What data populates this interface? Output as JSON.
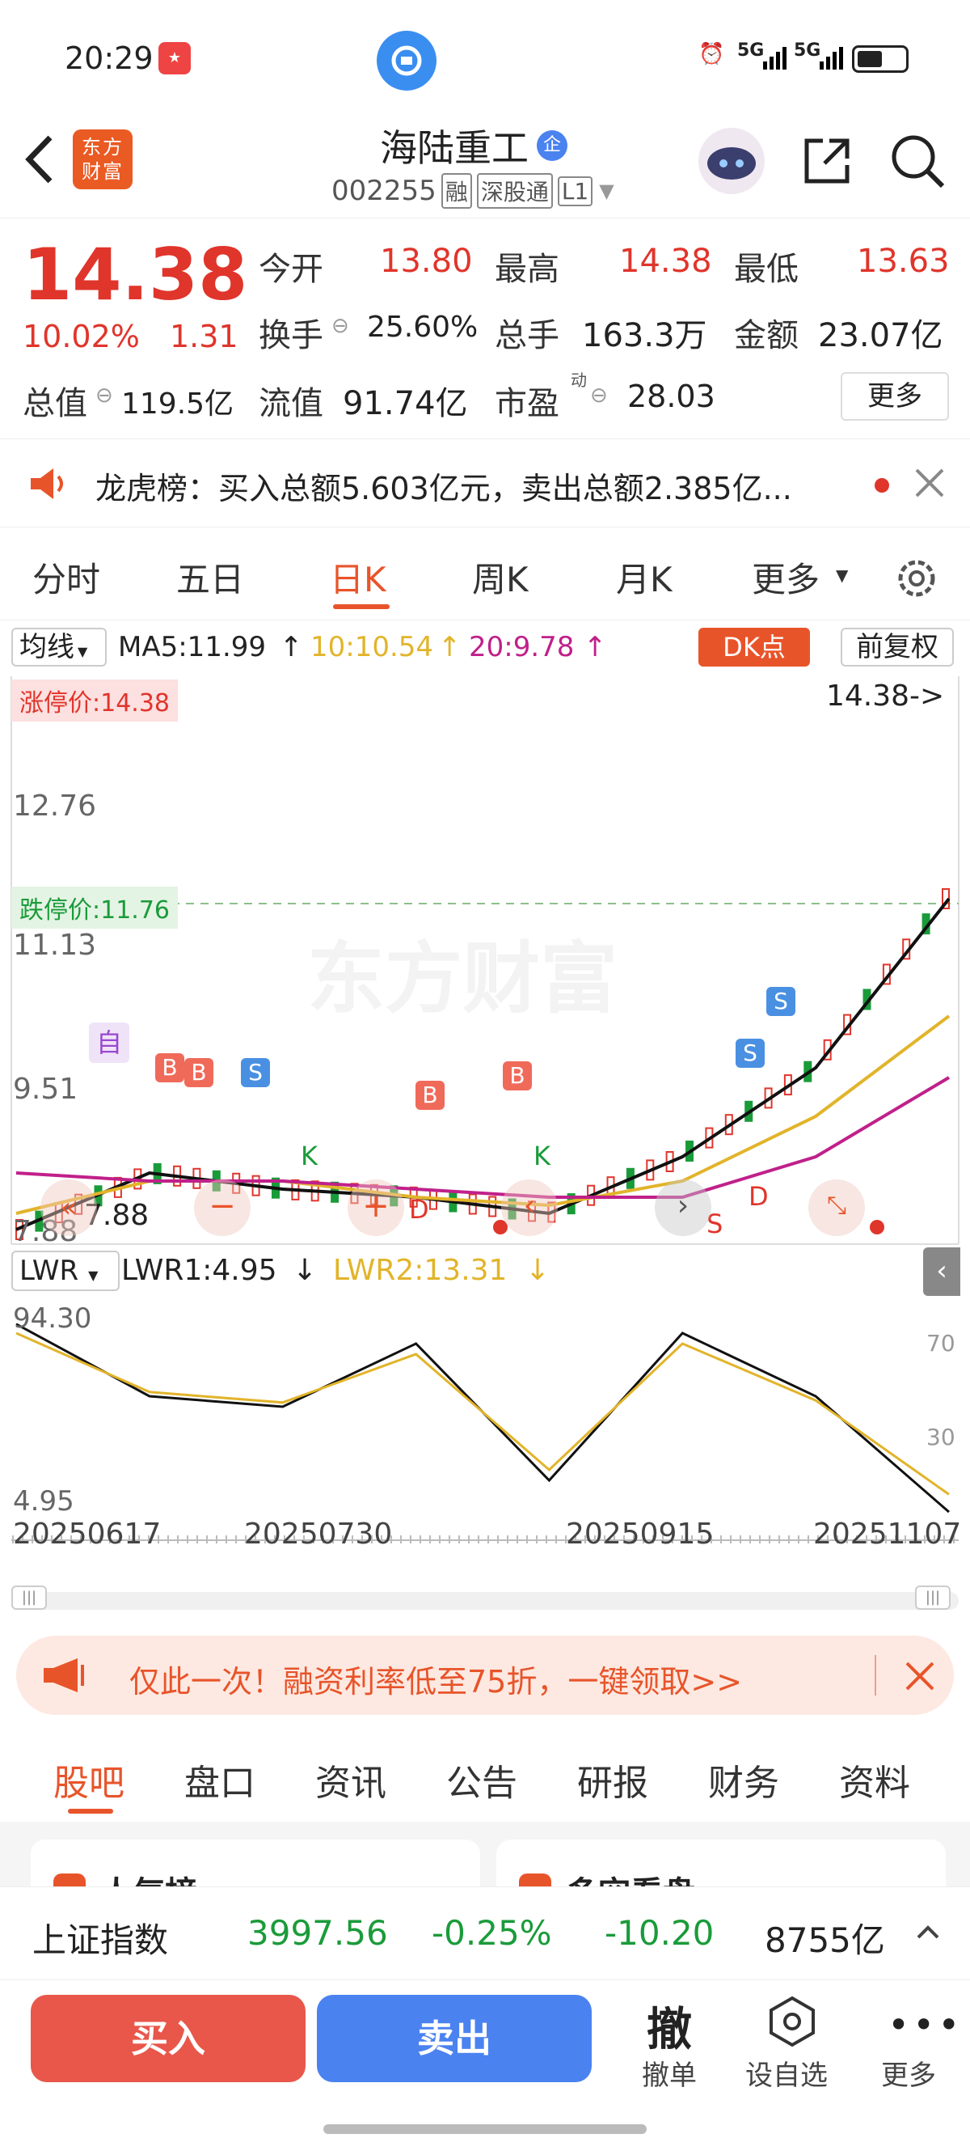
{
  "status_bar": {
    "time": "20:29",
    "signal1": "5G",
    "signal2": "5G"
  },
  "header": {
    "logo_text": "东方财富",
    "stock_name": "海陆重工",
    "badge": "企",
    "code": "002255",
    "tags": [
      "融",
      "深股通",
      "L1"
    ]
  },
  "quote": {
    "price": "14.38",
    "change_pct": "10.02%",
    "change": "1.31",
    "open_label": "今开",
    "open": "13.80",
    "high_label": "最高",
    "high": "14.38",
    "low_label": "最低",
    "low": "13.63",
    "turnover_label": "换手",
    "turnover": "25.60%",
    "volume_label": "总手",
    "volume": "163.3万",
    "amount_label": "金额",
    "amount": "23.07亿",
    "mktcap_label": "总值",
    "mktcap": "119.5亿",
    "float_label": "流值",
    "float": "91.74亿",
    "pe_label": "市盈",
    "pe_sup": "动",
    "pe": "28.03",
    "more_button": "更多"
  },
  "notice": {
    "text": "龙虎榜：买入总额5.603亿元，卖出总额2.385亿..."
  },
  "kline_tabs": {
    "items": [
      "分时",
      "五日",
      "日K",
      "周K",
      "月K",
      "更多"
    ],
    "active": 2
  },
  "indicator_bar": {
    "selector": "均线",
    "ma5": "MA5:11.99",
    "ma10": "10:10.54",
    "ma20": "20:9.78",
    "dk_button": "DK点",
    "adjust": "前复权"
  },
  "chart_labels": {
    "limit_up": "涨停价:14.38",
    "price_tag": "14.38->",
    "y_12_76": "12.76",
    "limit_down": "跌停价:11.76",
    "y_11_13": "11.13",
    "y_9_51": "9.51",
    "y_7_88": "7.88",
    "low_marker": "7.88",
    "watermark": "东方财富",
    "marker_zi": "自",
    "marker_b": "B",
    "marker_s": "S",
    "marker_k": "K",
    "marker_d": "D"
  },
  "lwr": {
    "selector": "LWR",
    "lwr1": "LWR1:4.95",
    "lwr2": "LWR2:13.31",
    "y_top": "94.30",
    "y_bottom": "4.95",
    "r70": "70",
    "r30": "30"
  },
  "chart_data": {
    "type": "line",
    "x": [
      "20250617",
      "20250730",
      "20250915",
      "20251107"
    ],
    "series": [
      {
        "name": "MA5",
        "values": [
          7.9,
          8.6,
          8.4,
          8.3,
          8.1,
          8.8,
          9.9,
          11.99
        ]
      },
      {
        "name": "MA10",
        "values": [
          8.1,
          8.5,
          8.5,
          8.3,
          8.2,
          8.5,
          9.3,
          10.54
        ]
      },
      {
        "name": "MA20",
        "values": [
          8.6,
          8.5,
          8.5,
          8.4,
          8.3,
          8.3,
          8.8,
          9.78
        ]
      },
      {
        "name": "LWR1",
        "values": [
          94.3,
          60,
          55,
          85,
          20,
          90,
          60,
          4.95
        ]
      },
      {
        "name": "LWR2",
        "values": [
          90,
          62,
          57,
          80,
          25,
          85,
          58,
          13.31
        ]
      }
    ],
    "ylim": [
      7.88,
      14.38
    ],
    "grid": false
  },
  "promo": {
    "text": "仅此一次！融资利率低至75折，一键领取>>"
  },
  "bottom_tabs": {
    "items": [
      "股吧",
      "盘口",
      "资讯",
      "公告",
      "研报",
      "财务",
      "资料"
    ],
    "active": 0
  },
  "cards": {
    "left": "人气榜",
    "right": "多空看盘"
  },
  "index_bar": {
    "name": "上证指数",
    "value": "3997.56",
    "pct": "-0.25%",
    "change": "-10.20",
    "amount": "8755亿"
  },
  "actions": {
    "buy": "买入",
    "sell": "卖出",
    "cancel_glyph": "撤",
    "cancel": "撤单",
    "watch": "设自选",
    "more": "更多"
  },
  "colors": {
    "up": "#e0352b",
    "down": "#1a9b3a",
    "accent": "#e8542a",
    "ma10": "#e2b42a",
    "ma20": "#c0208a",
    "sell": "#4a82f0"
  }
}
